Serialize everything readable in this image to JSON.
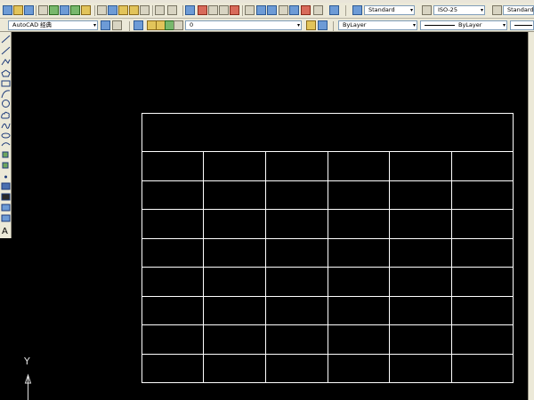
{
  "app": "AutoCAD",
  "toolbar_top": {
    "text_style": "Standard",
    "dim_style": "ISO-25",
    "table_style": "Standard"
  },
  "toolbar_second": {
    "workspace": "AutoCAD 经典",
    "layer": "0",
    "color": "ByLayer",
    "linetype": "ByLayer"
  },
  "draw_tools": [
    "line-icon",
    "construction-line-icon",
    "polyline-icon",
    "polygon-icon",
    "rectangle-icon",
    "arc-icon",
    "circle-icon",
    "revision-cloud-icon",
    "spline-icon",
    "ellipse-icon",
    "ellipse-arc-icon",
    "insert-block-icon",
    "make-block-icon",
    "point-icon",
    "hatch-icon",
    "gradient-icon",
    "region-icon",
    "table-icon",
    "multiline-text-icon"
  ],
  "multiline_text_glyph": "A",
  "ucs": {
    "y_label": "Y"
  },
  "colors": {
    "canvas": "#000000",
    "lines": "#ffffff",
    "chrome": "#ece9d8"
  }
}
